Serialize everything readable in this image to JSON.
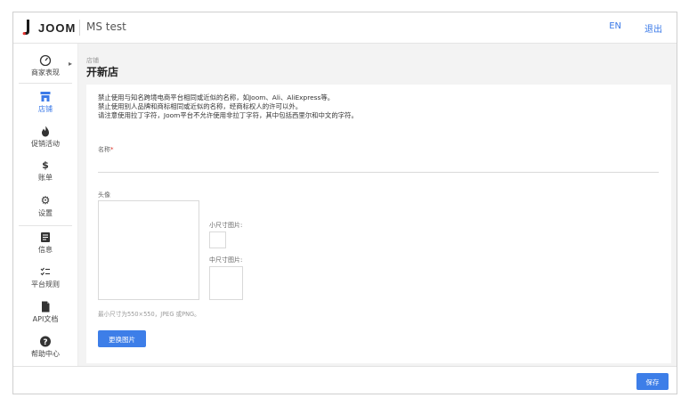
{
  "header": {
    "logo_text": "JOOM",
    "app_title": "MS test",
    "lang_label": "EN",
    "logout_label": "退出"
  },
  "sidebar": {
    "items": [
      {
        "label": "商家表现",
        "icon": "gauge-icon"
      },
      {
        "label": "店铺",
        "icon": "store-icon",
        "active": true
      },
      {
        "label": "促销活动",
        "icon": "flame-icon"
      },
      {
        "label": "账单",
        "icon": "dollar-icon"
      },
      {
        "label": "设置",
        "icon": "gear-icon"
      },
      {
        "label": "信息",
        "icon": "message-icon"
      },
      {
        "label": "平台规则",
        "icon": "checklist-icon"
      },
      {
        "label": "API文档",
        "icon": "document-icon"
      },
      {
        "label": "帮助中心",
        "icon": "help-icon"
      }
    ]
  },
  "page": {
    "breadcrumb": "店铺",
    "title": "开新店"
  },
  "rules": {
    "line1": "禁止使用与知名跨境电商平台相同或近似的名称，如Joom、Ali、AliExpress等。",
    "line2": "禁止使用别人品牌和商标相同或近似的名称，经商标权人的许可以外。",
    "line3": "请注意使用拉丁字符，Joom平台不允许使用非拉丁字符，其中包括西里尔和中文的字符。"
  },
  "form": {
    "name_label": "名称",
    "name_required_mark": "*",
    "name_value": "",
    "avatar_label": "头像",
    "small_image_label": "小尺寸图片:",
    "mid_image_label": "中尺寸图片:",
    "size_hint": "最小尺寸为550×550，JPEG 或PNG。",
    "replace_button": "更换图片"
  },
  "footer": {
    "save_button": "保存"
  },
  "colors": {
    "accent": "#3d7ee8",
    "brand_red": "#e8322e",
    "content_bg": "#f3f3f3"
  }
}
